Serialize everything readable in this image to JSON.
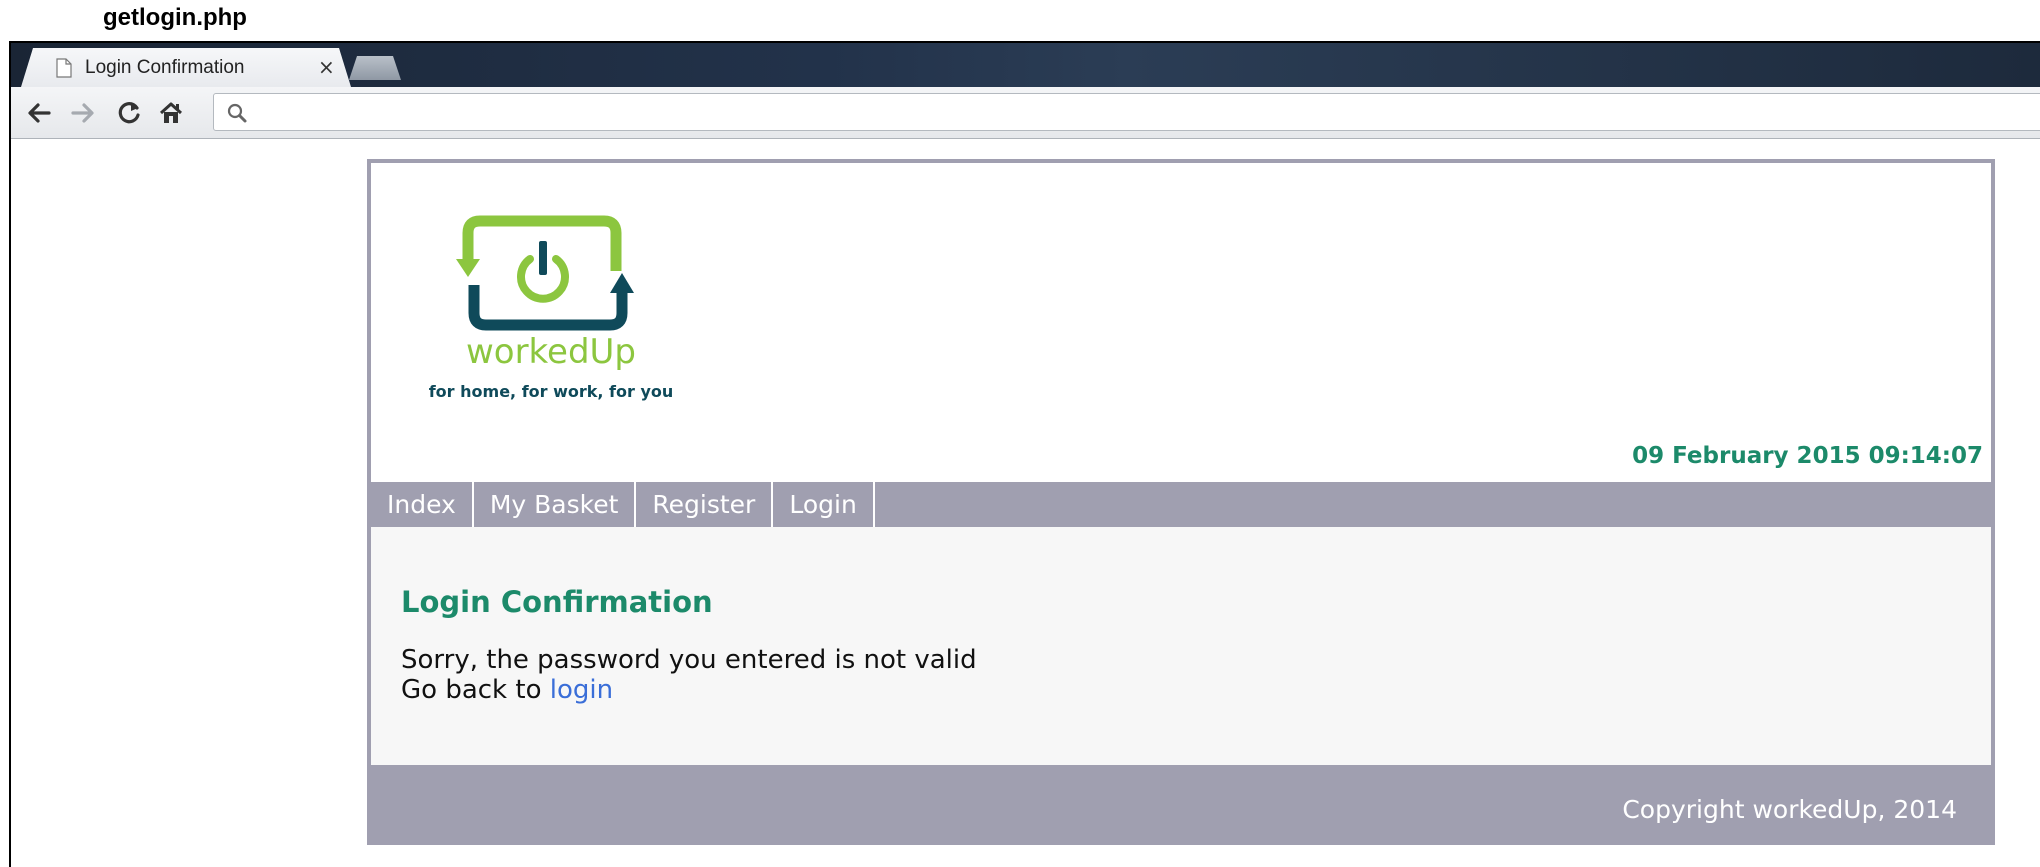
{
  "caption": "getlogin.php",
  "browser": {
    "tab": {
      "title": "Login Confirmation",
      "close_symbol": "×"
    },
    "toolbar": {
      "address_value": "",
      "address_placeholder": ""
    }
  },
  "site": {
    "logo": {
      "name": "workedUp",
      "tagline": "for home, for work, for you"
    },
    "datetime": "09 February 2015 09:14:07",
    "nav": [
      {
        "label": "Index"
      },
      {
        "label": "My Basket"
      },
      {
        "label": "Register"
      },
      {
        "label": "Login"
      }
    ],
    "content": {
      "heading": "Login Confirmation",
      "message": "Sorry, the password you entered is not valid",
      "goback_prefix": "Go back to ",
      "goback_link": "login"
    },
    "footer": {
      "copyright": "Copyright workedUp, 2014"
    }
  },
  "colors": {
    "brand_green": "#8cc63f",
    "brand_dark": "#0f4a5a",
    "heading_green": "#1c8a6a",
    "nav_gray": "#a09fb0",
    "link_blue": "#3a6ed8"
  }
}
